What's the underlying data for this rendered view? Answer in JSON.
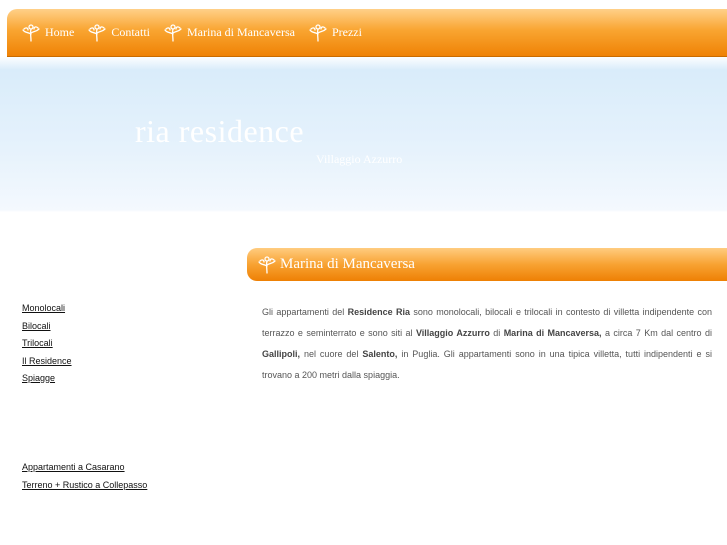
{
  "nav": {
    "items": [
      {
        "label": "Home"
      },
      {
        "label": "Contatti"
      },
      {
        "label": "Marina di Mancaversa"
      },
      {
        "label": "Prezzi"
      }
    ]
  },
  "header": {
    "title": "ria residence",
    "subtitle": "Villaggio Azzurro"
  },
  "sidebar": {
    "links": [
      {
        "label": "Monolocali"
      },
      {
        "label": "Bilocali"
      },
      {
        "label": "Trilocali"
      },
      {
        "label": "Il Residence"
      },
      {
        "label": "Spiagge"
      }
    ],
    "extra_links": [
      {
        "label": "Appartamenti a Casarano"
      },
      {
        "label": "Terreno + Rustico a Collepasso"
      }
    ]
  },
  "content": {
    "title": "Marina di Mancaversa",
    "p1": "Gli appartamenti del ",
    "b1": "Residence Ria",
    "p2": " sono monolocali, bilocali e trilocali in contesto di villetta indipendente con terrazzo e seminterrato e sono siti al ",
    "b2": "Villaggio Azzurro",
    "p3": " di ",
    "b3": "Marina di Mancaversa,",
    "p4": " a circa 7 Km dal centro di ",
    "b4": "Gallipoli,",
    "p5": " nel cuore del ",
    "b5": "Salento,",
    "p6": " in Puglia. Gli appartamenti sono in una tipica villetta, tutti indipendenti e si trovano a 200 metri dalla spiaggia."
  },
  "colors": {
    "nav_orange": "#f9a531",
    "nav_dark_orange": "#ef8205",
    "sky_blue": "#e6f2fc",
    "text_gray": "#555555"
  },
  "icons": {
    "nav_icon": "flower-icon"
  }
}
